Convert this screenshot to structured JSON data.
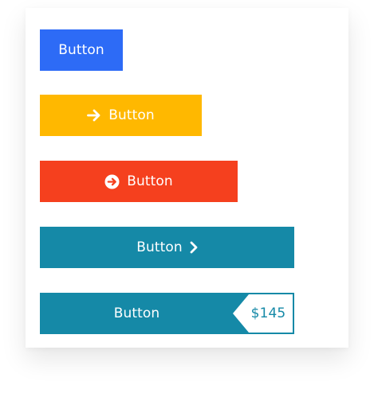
{
  "buttons": [
    {
      "label": "Button",
      "color": "#2D6BF6",
      "icon": "none"
    },
    {
      "label": "Button",
      "color": "#FFB800",
      "icon": "arrow-right-icon"
    },
    {
      "label": "Button",
      "color": "#F5401E",
      "icon": "circle-arrow-right-icon"
    },
    {
      "label": "Button",
      "color": "#1589A7",
      "icon": "chevron-right-icon"
    },
    {
      "label": "Button",
      "color": "#1589A7",
      "price": "$145"
    }
  ]
}
